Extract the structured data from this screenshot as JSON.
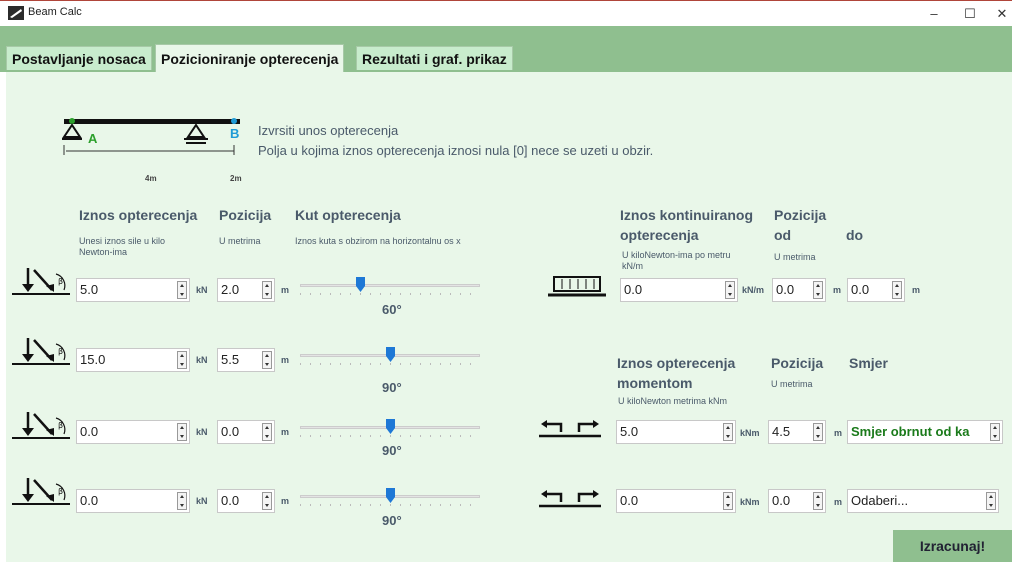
{
  "window": {
    "title": "Beam Calc",
    "minimize_glyph": "–",
    "maximize_glyph": "☐",
    "close_glyph": "✕"
  },
  "tabs": [
    {
      "label": "Postavljanje nosaca",
      "active": false
    },
    {
      "label": "Pozicioniranje opterecenja",
      "active": true
    },
    {
      "label": "Rezultati i  graf. prikaz",
      "active": false
    }
  ],
  "beam_diagram": {
    "label_a": "A",
    "label_b": "B",
    "dim_left": "4m",
    "dim_right": "2m"
  },
  "info": {
    "line1": "Izvrsiti unos opterecenja",
    "line2": "Polja u kojima iznos opterecenja iznosi nula [0] nece se uzeti u obzir."
  },
  "point_loads": {
    "header_force": "Iznos opterecenja",
    "sub_force": "Unesi iznos sile u kilo Newton-ima",
    "header_position": "Pozicija",
    "sub_position": "U metrima",
    "header_angle": "Kut opterecenja",
    "sub_angle": "Iznos kuta s obzirom na horizontalnu os x",
    "force_unit": "kN",
    "position_unit": "m",
    "rows": [
      {
        "force": "5.0",
        "position": "2.0",
        "angle": "60°",
        "angle_value": 60
      },
      {
        "force": "15.0",
        "position": "5.5",
        "angle": "90°",
        "angle_value": 90
      },
      {
        "force": "0.0",
        "position": "0.0",
        "angle": "90°",
        "angle_value": 90
      },
      {
        "force": "0.0",
        "position": "0.0",
        "angle": "90°",
        "angle_value": 90
      }
    ]
  },
  "distributed_load": {
    "header_amount_1": "Iznos kontinuiranog",
    "header_amount_2": "opterecenja",
    "sub_amount": "U kiloNewton-ima po metru kN/m",
    "header_position_1": "Pozicija",
    "header_position_2": "od",
    "header_to": "do",
    "sub_position": "U metrima",
    "amount": "0.0",
    "amount_unit": "kN/m",
    "from": "0.0",
    "to": "0.0",
    "position_unit": "m"
  },
  "moment_loads": {
    "header_amount_1": "Iznos opterecenja",
    "header_amount_2": "momentom",
    "sub_amount": "U kiloNewton metrima kNm",
    "header_position": "Pozicija",
    "sub_position": "U metrima",
    "header_direction": "Smjer",
    "amount_unit": "kNm",
    "position_unit": "m",
    "rows": [
      {
        "amount": "5.0",
        "position": "4.5",
        "direction": "Smjer obrnut od ka"
      },
      {
        "amount": "0.0",
        "position": "0.0",
        "direction": "Odaberi..."
      }
    ]
  },
  "calculate_button": "Izracunaj!",
  "colors": {
    "tabstrip": "#8fbf8f",
    "panel": "#e9f7e9",
    "header_text": "#4a5a6a",
    "slider_thumb": "#1e78d6"
  }
}
